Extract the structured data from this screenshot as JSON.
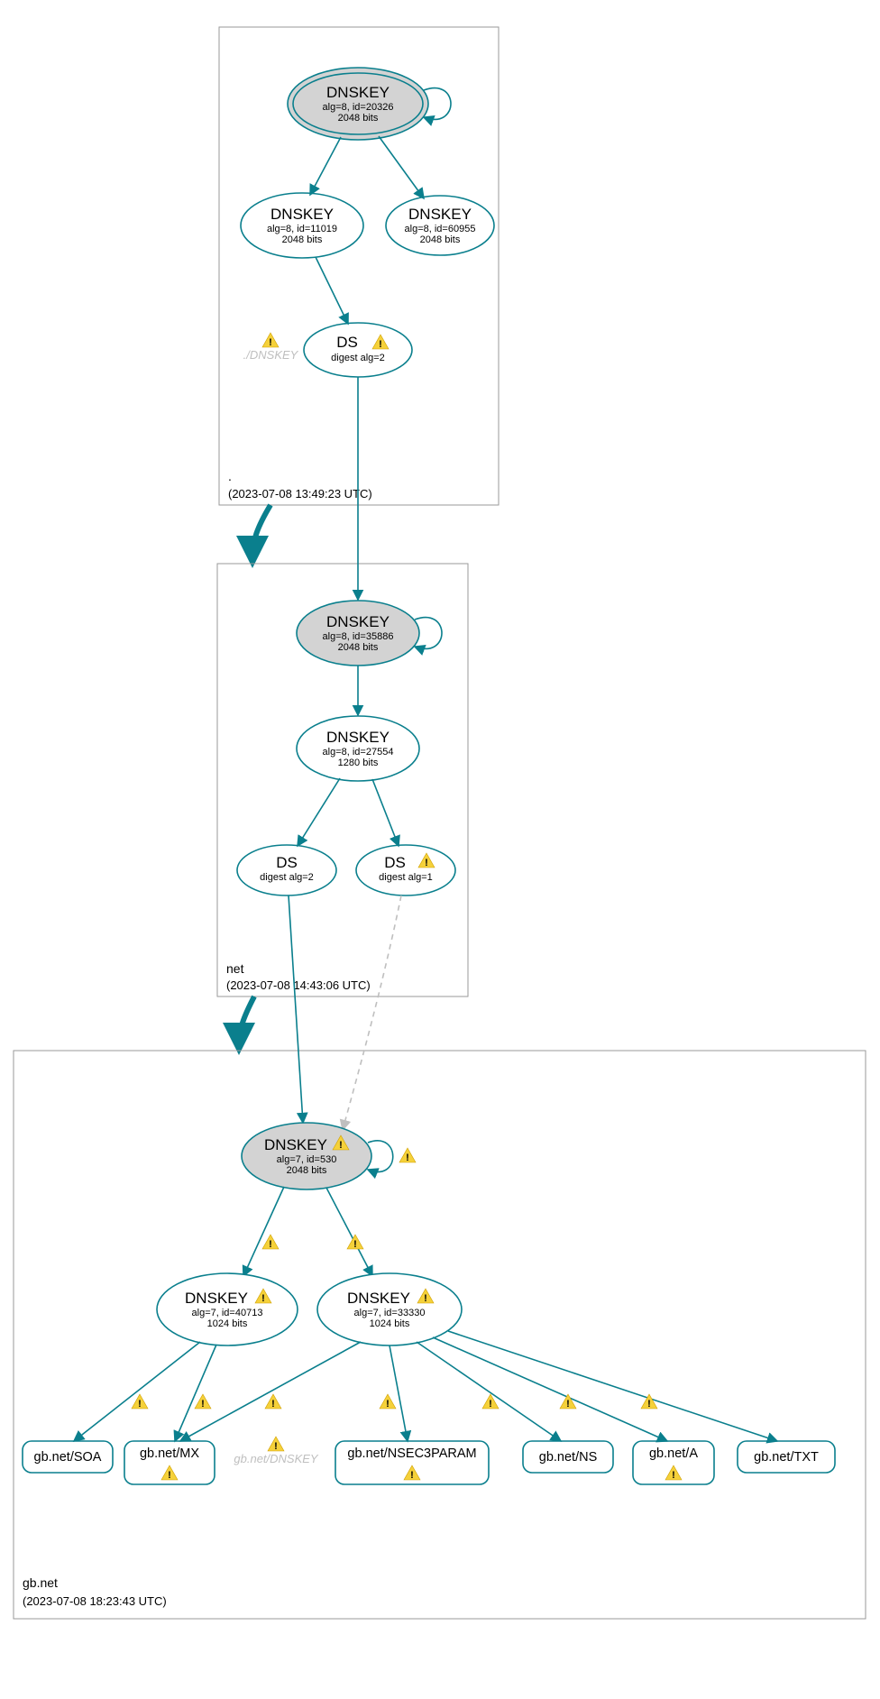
{
  "zones": {
    "root": {
      "name": ".",
      "timestamp": "(2023-07-08 13:49:23 UTC)",
      "ksk": {
        "title": "DNSKEY",
        "sub1": "alg=8, id=20326",
        "sub2": "2048 bits"
      },
      "zsk1": {
        "title": "DNSKEY",
        "sub1": "alg=8, id=11019",
        "sub2": "2048 bits"
      },
      "zsk2": {
        "title": "DNSKEY",
        "sub1": "alg=8, id=60955",
        "sub2": "2048 bits"
      },
      "ds": {
        "title": "DS",
        "sub1": "digest alg=2"
      },
      "ghost_dnskey": "./DNSKEY"
    },
    "net": {
      "name": "net",
      "timestamp": "(2023-07-08 14:43:06 UTC)",
      "ksk": {
        "title": "DNSKEY",
        "sub1": "alg=8, id=35886",
        "sub2": "2048 bits"
      },
      "zsk": {
        "title": "DNSKEY",
        "sub1": "alg=8, id=27554",
        "sub2": "1280 bits"
      },
      "ds1": {
        "title": "DS",
        "sub1": "digest alg=2"
      },
      "ds2": {
        "title": "DS",
        "sub1": "digest alg=1"
      }
    },
    "gbnet": {
      "name": "gb.net",
      "timestamp": "(2023-07-08 18:23:43 UTC)",
      "ksk": {
        "title": "DNSKEY",
        "sub1": "alg=7, id=530",
        "sub2": "2048 bits"
      },
      "zsk1": {
        "title": "DNSKEY",
        "sub1": "alg=7, id=40713",
        "sub2": "1024 bits"
      },
      "zsk2": {
        "title": "DNSKEY",
        "sub1": "alg=7, id=33330",
        "sub2": "1024 bits"
      },
      "ghost_dnskey": "gb.net/DNSKEY",
      "rr": {
        "soa": "gb.net/SOA",
        "mx": "gb.net/MX",
        "nsec": "gb.net/NSEC3PARAM",
        "ns": "gb.net/NS",
        "a": "gb.net/A",
        "txt": "gb.net/TXT"
      }
    }
  }
}
